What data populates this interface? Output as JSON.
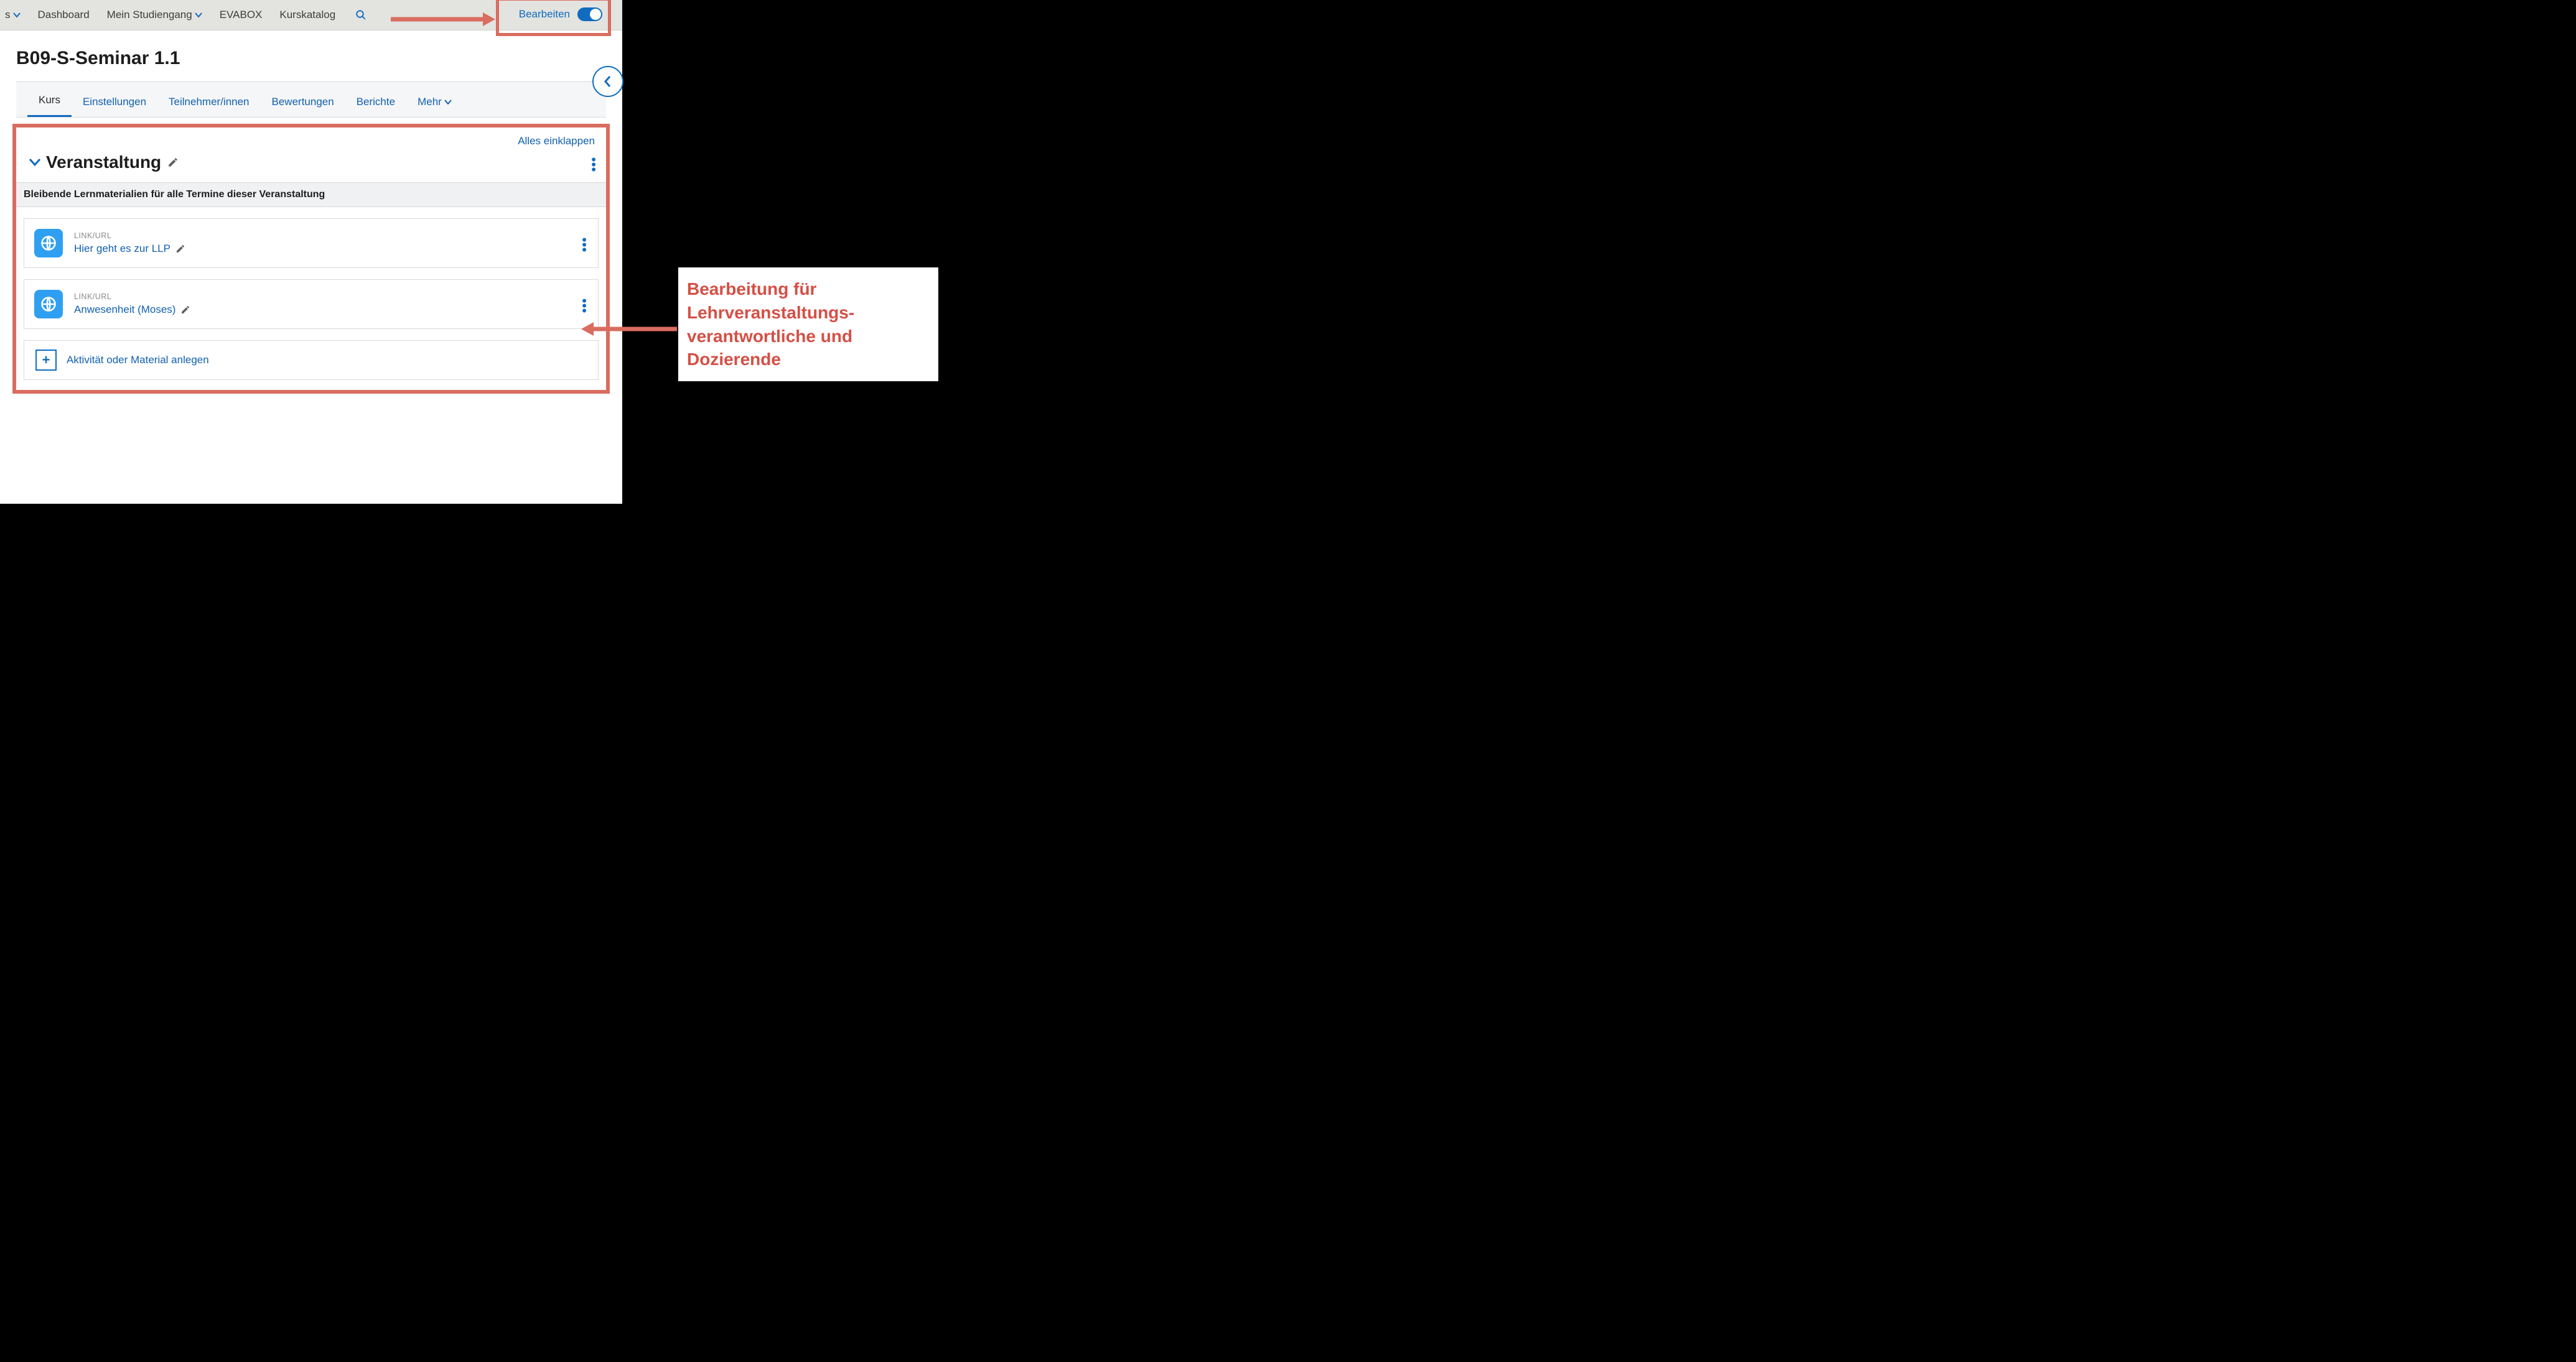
{
  "nav": {
    "partial_first_suffix": "s",
    "items": [
      "Dashboard",
      "Mein Studiengang",
      "EVABOX",
      "Kurskatalog"
    ],
    "dropdown_indices": [
      1
    ],
    "edit_label": "Bearbeiten"
  },
  "page": {
    "title": "B09-S-Seminar 1.1"
  },
  "tabs": {
    "items": [
      "Kurs",
      "Einstellungen",
      "Teilnehmer/innen",
      "Bewertungen",
      "Berichte",
      "Mehr"
    ],
    "more_index": 5,
    "active_index": 0
  },
  "content": {
    "collapse_all": "Alles einklappen",
    "section_title": "Veranstaltung",
    "section_banner": "Bleibende Lernmaterialien für alle Termine dieser Veranstaltung",
    "activities": [
      {
        "type": "LINK/URL",
        "title": "Hier geht es zur LLP"
      },
      {
        "type": "LINK/URL",
        "title": "Anwesenheit (Moses)"
      }
    ],
    "add_activity": "Aktivität oder Material anlegen"
  },
  "callout": {
    "line1": "Bearbeitung für",
    "line2": "Lehrveranstaltungs-",
    "line3": "verantwortliche und",
    "line4": "Dozierende"
  },
  "colors": {
    "blue": "#0f6cbf",
    "accent_red": "#d96d5f",
    "accent_red_text": "#d54f45"
  }
}
